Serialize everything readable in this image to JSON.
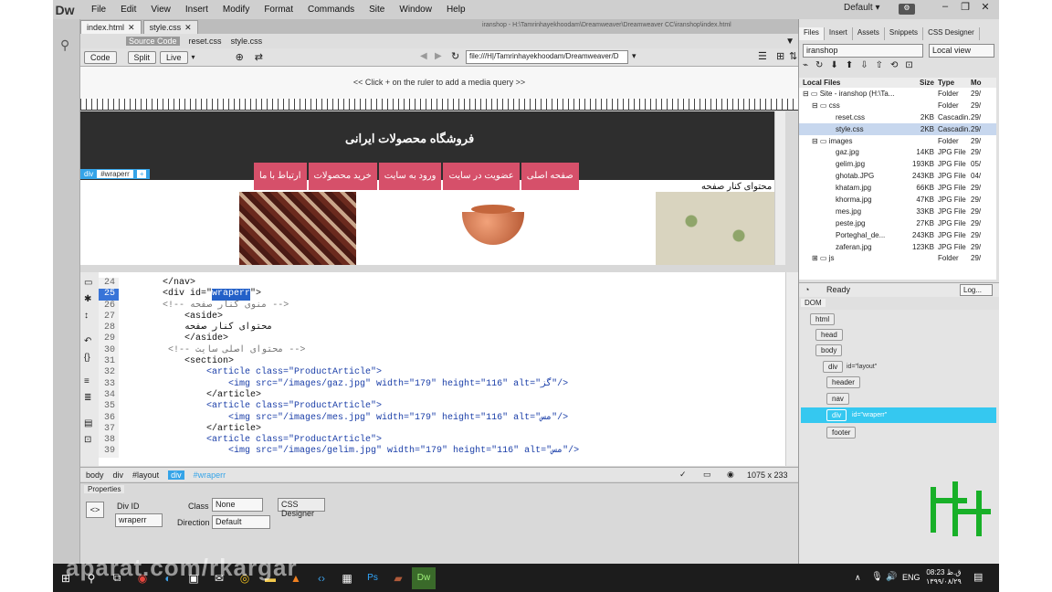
{
  "app": {
    "logo": "Dw",
    "workspace": "Default"
  },
  "menu": [
    "File",
    "Edit",
    "View",
    "Insert",
    "Modify",
    "Format",
    "Commands",
    "Site",
    "Window",
    "Help"
  ],
  "tabs": [
    {
      "label": "index.html"
    },
    {
      "label": "style.css"
    }
  ],
  "path_text": "iranshop - H:\\Tamrinhayekhoodam\\Dreamweaver\\Dreamweaver CC\\iranshop\\index.html",
  "related_files": [
    "Source Code",
    "reset.css",
    "style.css"
  ],
  "view_buttons": {
    "code": "Code",
    "split": "Split",
    "live": "Live"
  },
  "address": "file:///H|/Tamrinhayekhoodam/Dreamweaver/D",
  "media_query_hint": "<< Click + on the ruler to add a media query >>",
  "design": {
    "shop_title": "فروشگاه محصولات ایرانی",
    "nav": [
      "صفحه اصلی",
      "عضویت در سایت",
      "ورود به سایت",
      "خرید محصولات",
      "ارتباط با ما"
    ],
    "div_tag": "div",
    "div_id": "#wraperr",
    "sidebar": "محتوای کنار صفحه"
  },
  "code_lines": [
    {
      "n": "24",
      "t": "        </nav>"
    },
    {
      "n": "25",
      "pre": "        <div id=\"",
      "hl": "wraperr",
      "post": "\">"
    },
    {
      "n": "26",
      "t": "        <!-- منوی کنار صفحه -->"
    },
    {
      "n": "27",
      "t": "            <aside>"
    },
    {
      "n": "28",
      "t": "            محتوای کنار صفحه"
    },
    {
      "n": "29",
      "t": "            </aside>"
    },
    {
      "n": "30",
      "t": "         <!-- محتوای اصلی سایت -->"
    },
    {
      "n": "31",
      "t": "            <section>"
    },
    {
      "n": "32",
      "t": "                <article class=\"ProductArticle\">"
    },
    {
      "n": "33",
      "t": "                    <img src=\"/images/gaz.jpg\" width=\"179\" height=\"116\" alt=\"گز\"/>"
    },
    {
      "n": "34",
      "t": "                </article>"
    },
    {
      "n": "35",
      "t": "                <article class=\"ProductArticle\">"
    },
    {
      "n": "36",
      "t": "                    <img src=\"/images/mes.jpg\" width=\"179\" height=\"116\" alt=\"مس\"/>"
    },
    {
      "n": "37",
      "t": "                </article>"
    },
    {
      "n": "38",
      "t": "                <article class=\"ProductArticle\">"
    },
    {
      "n": "39",
      "t": "                    <img src=\"/images/gelim.jpg\" width=\"179\" height=\"116\" alt=\"مس\"/>"
    }
  ],
  "status_crumbs": [
    "body",
    "div",
    "#layout",
    "div",
    "#wraperr"
  ],
  "status_size": "1075 x 233",
  "properties": {
    "title": "Properties",
    "div_id_label": "Div ID",
    "div_id_value": "wraperr",
    "class_label": "Class",
    "class_value": "None",
    "css_designer": "CSS Designer",
    "direction_label": "Direction",
    "direction_value": "Default"
  },
  "files_panel": {
    "tabs": [
      "Files",
      "Insert",
      "Assets",
      "Snippets",
      "CSS Designer"
    ],
    "site": "iranshop",
    "view": "Local view",
    "headers": [
      "Local Files",
      "Size",
      "Type",
      "Mo"
    ],
    "rows": [
      {
        "name": "Site - iranshop (H:\\Ta...",
        "size": "",
        "type": "Folder",
        "mod": "29/"
      },
      {
        "name": "css",
        "size": "",
        "type": "Folder",
        "mod": "29/"
      },
      {
        "name": "reset.css",
        "size": "2KB",
        "type": "Cascadin...",
        "mod": "29/"
      },
      {
        "name": "style.css",
        "size": "2KB",
        "type": "Cascadin...",
        "mod": "29/"
      },
      {
        "name": "images",
        "size": "",
        "type": "Folder",
        "mod": "29/"
      },
      {
        "name": "gaz.jpg",
        "size": "14KB",
        "type": "JPG File",
        "mod": "29/"
      },
      {
        "name": "gelim.jpg",
        "size": "193KB",
        "type": "JPG File",
        "mod": "05/"
      },
      {
        "name": "ghotab.JPG",
        "size": "243KB",
        "type": "JPG File",
        "mod": "04/"
      },
      {
        "name": "khatam.jpg",
        "size": "66KB",
        "type": "JPG File",
        "mod": "29/"
      },
      {
        "name": "khorma.jpg",
        "size": "47KB",
        "type": "JPG File",
        "mod": "29/"
      },
      {
        "name": "mes.jpg",
        "size": "33KB",
        "type": "JPG File",
        "mod": "29/"
      },
      {
        "name": "peste.jpg",
        "size": "27KB",
        "type": "JPG File",
        "mod": "29/"
      },
      {
        "name": "Porteghal_de...",
        "size": "243KB",
        "type": "JPG File",
        "mod": "29/"
      },
      {
        "name": "zaferan.jpg",
        "size": "123KB",
        "type": "JPG File",
        "mod": "29/"
      },
      {
        "name": "js",
        "size": "",
        "type": "Folder",
        "mod": "29/"
      }
    ],
    "status": "Ready",
    "log": "Log..."
  },
  "dom_panel": {
    "title": "DOM",
    "nodes": [
      {
        "tag": "html",
        "attr": ""
      },
      {
        "tag": "head",
        "attr": ""
      },
      {
        "tag": "body",
        "attr": ""
      },
      {
        "tag": "div",
        "attr": "id=\"layout\""
      },
      {
        "tag": "header",
        "attr": ""
      },
      {
        "tag": "nav",
        "attr": ""
      },
      {
        "tag": "div",
        "attr": "id=\"wraperr\""
      },
      {
        "tag": "footer",
        "attr": ""
      }
    ]
  },
  "taskbar": {
    "lang": "ENG",
    "time": "08:23 ق.ظ",
    "date": "۱۳۹۹/۰۸/۲۹"
  },
  "watermark": "aparat.com/rkargar"
}
